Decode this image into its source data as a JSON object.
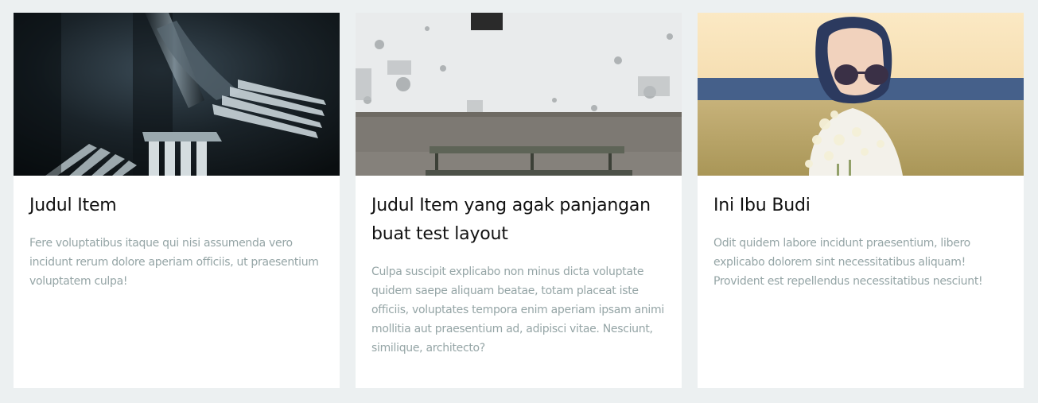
{
  "cards": [
    {
      "image": "forks-photo",
      "title": "Judul Item",
      "text": "Fere voluptatibus itaque qui nisi assumenda vero incidunt rerum dolore aperiam officiis, ut praesentium voluptatem culpa!"
    },
    {
      "image": "wall-bench-photo",
      "title": "Judul Item yang agak panjangan buat test layout",
      "text": "Culpa suscipit explicabo non minus dicta voluptate quidem saepe aliquam beatae, totam placeat iste officiis, voluptates tempora enim aperiam ipsam animi mollitia aut praesentium ad, adipisci vitae. Nesciunt, similique, architecto?"
    },
    {
      "image": "woman-sunglasses-field-photo",
      "title": "Ini Ibu Budi",
      "text": "Odit quidem labore incidunt praesentium, libero explicabo dolorem sint necessitatibus aliquam! Provident est repellendus necessitatibus nesciunt!"
    }
  ],
  "colors": {
    "page_background": "#ecf0f1",
    "card_background": "#ffffff",
    "title": "#111111",
    "body_text": "#95a5a6"
  }
}
